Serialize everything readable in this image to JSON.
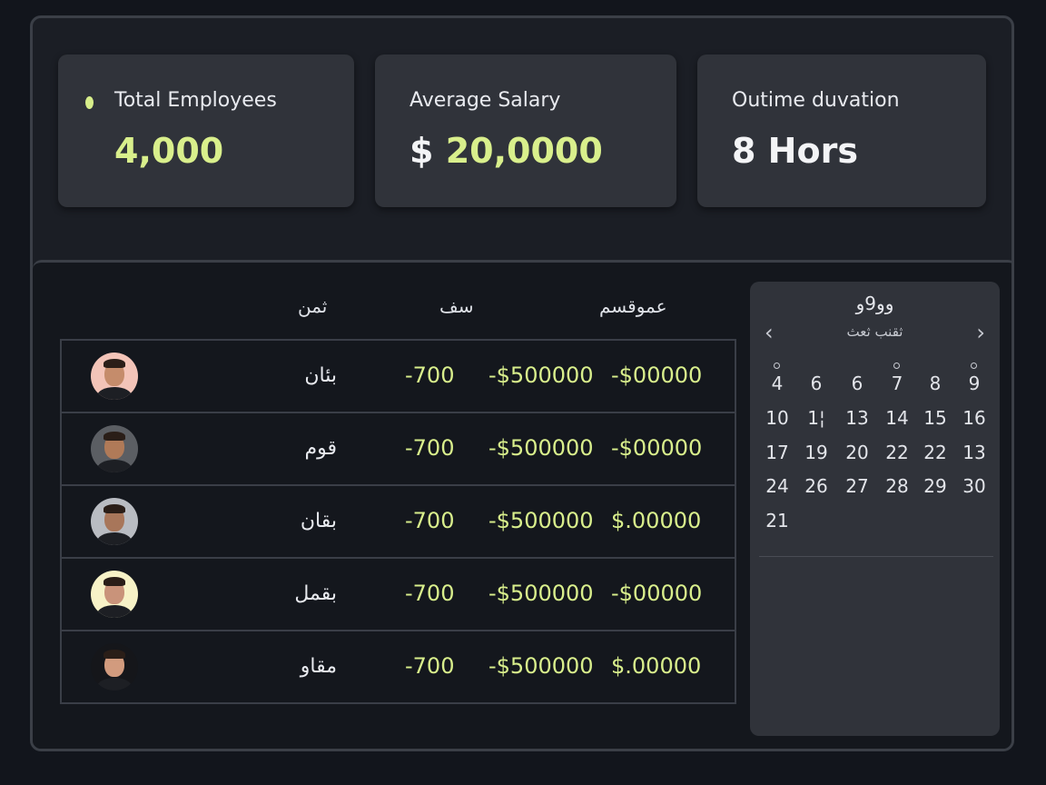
{
  "stats": [
    {
      "label": "Total Employees",
      "value": "4,000"
    },
    {
      "label": "Average Salary",
      "value_prefix": "$",
      "value": "20,0000"
    },
    {
      "label": "Outime duvation",
      "value": "8 Hors"
    }
  ],
  "table": {
    "headers": [
      "ثمن",
      "سف",
      "عموقسم"
    ],
    "rows": [
      {
        "name": "بئان",
        "col1": "-700",
        "col2": "-$500000",
        "col3": "-$00000",
        "avatar_bg": "#f3c4b8",
        "skin": "#c58c6b"
      },
      {
        "name": "قوم",
        "col1": "-700",
        "col2": "-$500000",
        "col3": "-$00000",
        "avatar_bg": "#5b5e63",
        "skin": "#b07a58"
      },
      {
        "name": "بقان",
        "col1": "-700",
        "col2": "-$500000",
        "col3": "$.00000",
        "avatar_bg": "#b9bcc2",
        "skin": "#a8765a"
      },
      {
        "name": "بقمل",
        "col1": "-700",
        "col2": "-$500000",
        "col3": "-$00000",
        "avatar_bg": "#f7f2c7",
        "skin": "#c9937a"
      },
      {
        "name": "مقاو",
        "col1": "-700",
        "col2": "-$500000",
        "col3": "$.00000",
        "avatar_bg": "#15161a",
        "skin": "#d29b7e"
      }
    ]
  },
  "calendar": {
    "title": "وو9و",
    "subtitle": "ثقنب ثعث",
    "prev_icon": "‹",
    "next_icon": "›",
    "weeks": [
      [
        "4",
        "6",
        "6",
        "7",
        "8",
        "9"
      ],
      [
        "10",
        "1¦",
        "13",
        "14",
        "15",
        "16"
      ],
      [
        "17",
        "19",
        "20",
        "22",
        "22",
        "13"
      ],
      [
        "24",
        "26",
        "27",
        "28",
        "29",
        "30"
      ],
      [
        "21"
      ]
    ],
    "marked_days": [
      "4",
      "7",
      "9"
    ]
  },
  "colors": {
    "accent": "#d9ef8c",
    "card": "#30333a",
    "frame": "#1b1e25"
  }
}
